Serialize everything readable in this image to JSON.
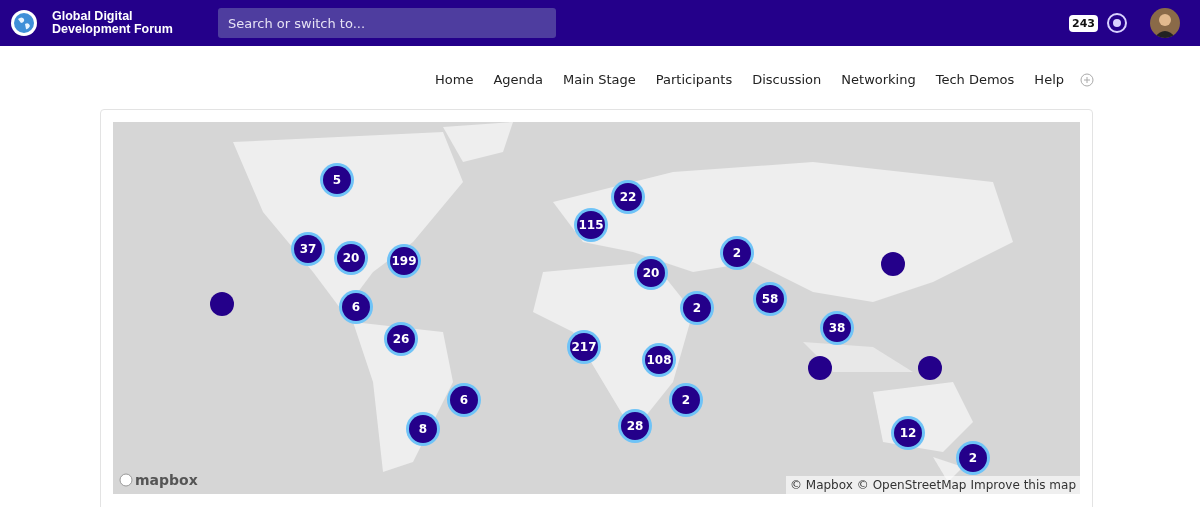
{
  "header": {
    "logo_text": "Global Digital Development Forum",
    "search": {
      "placeholder": "Search or switch to..."
    },
    "online_count": "243"
  },
  "nav": [
    {
      "label": "Home"
    },
    {
      "label": "Agenda"
    },
    {
      "label": "Main Stage"
    },
    {
      "label": "Participants"
    },
    {
      "label": "Discussion"
    },
    {
      "label": "Networking"
    },
    {
      "label": "Tech Demos"
    },
    {
      "label": "Help"
    }
  ],
  "map": {
    "markers": [
      {
        "kind": "cluster",
        "count": "5"
      },
      {
        "kind": "cluster",
        "count": "22"
      },
      {
        "kind": "cluster",
        "count": "115"
      },
      {
        "kind": "cluster",
        "count": "37"
      },
      {
        "kind": "cluster",
        "count": "20"
      },
      {
        "kind": "cluster",
        "count": "199"
      },
      {
        "kind": "cluster",
        "count": "2"
      },
      {
        "kind": "dot"
      },
      {
        "kind": "cluster",
        "count": "20"
      },
      {
        "kind": "dot"
      },
      {
        "kind": "cluster",
        "count": "6"
      },
      {
        "kind": "cluster",
        "count": "2"
      },
      {
        "kind": "cluster",
        "count": "58"
      },
      {
        "kind": "cluster",
        "count": "38"
      },
      {
        "kind": "cluster",
        "count": "26"
      },
      {
        "kind": "cluster",
        "count": "217"
      },
      {
        "kind": "cluster",
        "count": "108"
      },
      {
        "kind": "dot"
      },
      {
        "kind": "dot"
      },
      {
        "kind": "cluster",
        "count": "6"
      },
      {
        "kind": "cluster",
        "count": "2"
      },
      {
        "kind": "cluster",
        "count": "8"
      },
      {
        "kind": "cluster",
        "count": "28"
      },
      {
        "kind": "cluster",
        "count": "12"
      },
      {
        "kind": "cluster",
        "count": "2"
      }
    ],
    "logo_text": "mapbox",
    "attribution": [
      {
        "label": "© Mapbox"
      },
      {
        "label": "© OpenStreetMap"
      },
      {
        "label": "Improve this map"
      }
    ]
  }
}
